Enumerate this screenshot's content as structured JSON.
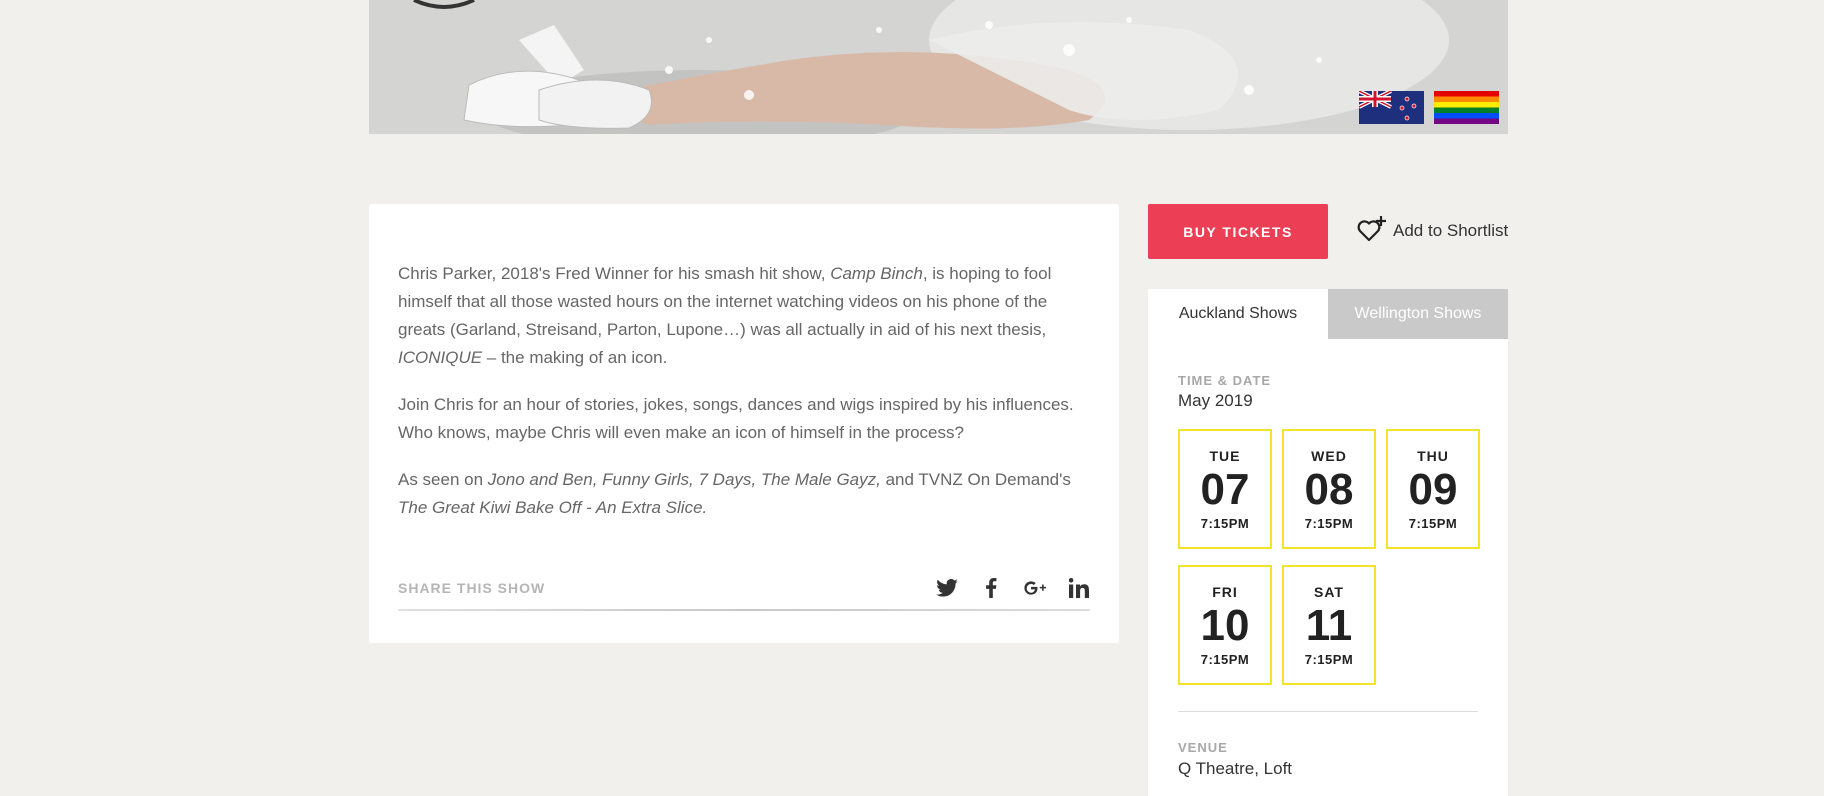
{
  "flags": {
    "nz": "new-zealand-flag",
    "pride": "rainbow-pride-flag"
  },
  "description": {
    "p1_a": "Chris Parker, 2018's Fred Winner for his smash hit show, ",
    "p1_em": "Camp Binch",
    "p1_b": ", is hoping to fool himself that all those wasted hours on the internet watching videos on his phone of the greats (Garland, Streisand, Parton, Lupone…) was all actually in aid of his next thesis, ",
    "p1_em2": "ICONIQUE",
    "p1_c": " – the making of an icon.",
    "p2": "Join Chris for an hour of stories, jokes, songs, dances and wigs inspired by his influences. Who knows, maybe Chris will even make an icon of himself in the process?",
    "p3_a": "As seen on ",
    "p3_em": "Jono and Ben, Funny Girls, 7 Days, The Male Gayz,",
    "p3_b": " and TVNZ On Demand's ",
    "p3_em2": "The Great Kiwi Bake Off - An Extra Slice."
  },
  "share": {
    "label": "SHARE THIS SHOW",
    "icons": [
      "twitter-icon",
      "facebook-icon",
      "google-plus-icon",
      "linkedin-icon"
    ]
  },
  "actions": {
    "buy_label": "BUY TICKETS",
    "shortlist_label": "Add to Shortlist"
  },
  "tabs": {
    "auckland": "Auckland Shows",
    "wellington": "Wellington Shows"
  },
  "schedule": {
    "label": "TIME & DATE",
    "month": "May 2019",
    "dates": [
      {
        "day": "TUE",
        "num": "07",
        "time": "7:15PM"
      },
      {
        "day": "WED",
        "num": "08",
        "time": "7:15PM"
      },
      {
        "day": "THU",
        "num": "09",
        "time": "7:15PM"
      },
      {
        "day": "FRI",
        "num": "10",
        "time": "7:15PM"
      },
      {
        "day": "SAT",
        "num": "11",
        "time": "7:15PM"
      }
    ]
  },
  "venue": {
    "label": "VENUE",
    "value": "Q Theatre, Loft"
  },
  "colors": {
    "accent": "#ec3f56",
    "date_border": "#f5e22a",
    "background": "#f1f0ed"
  }
}
